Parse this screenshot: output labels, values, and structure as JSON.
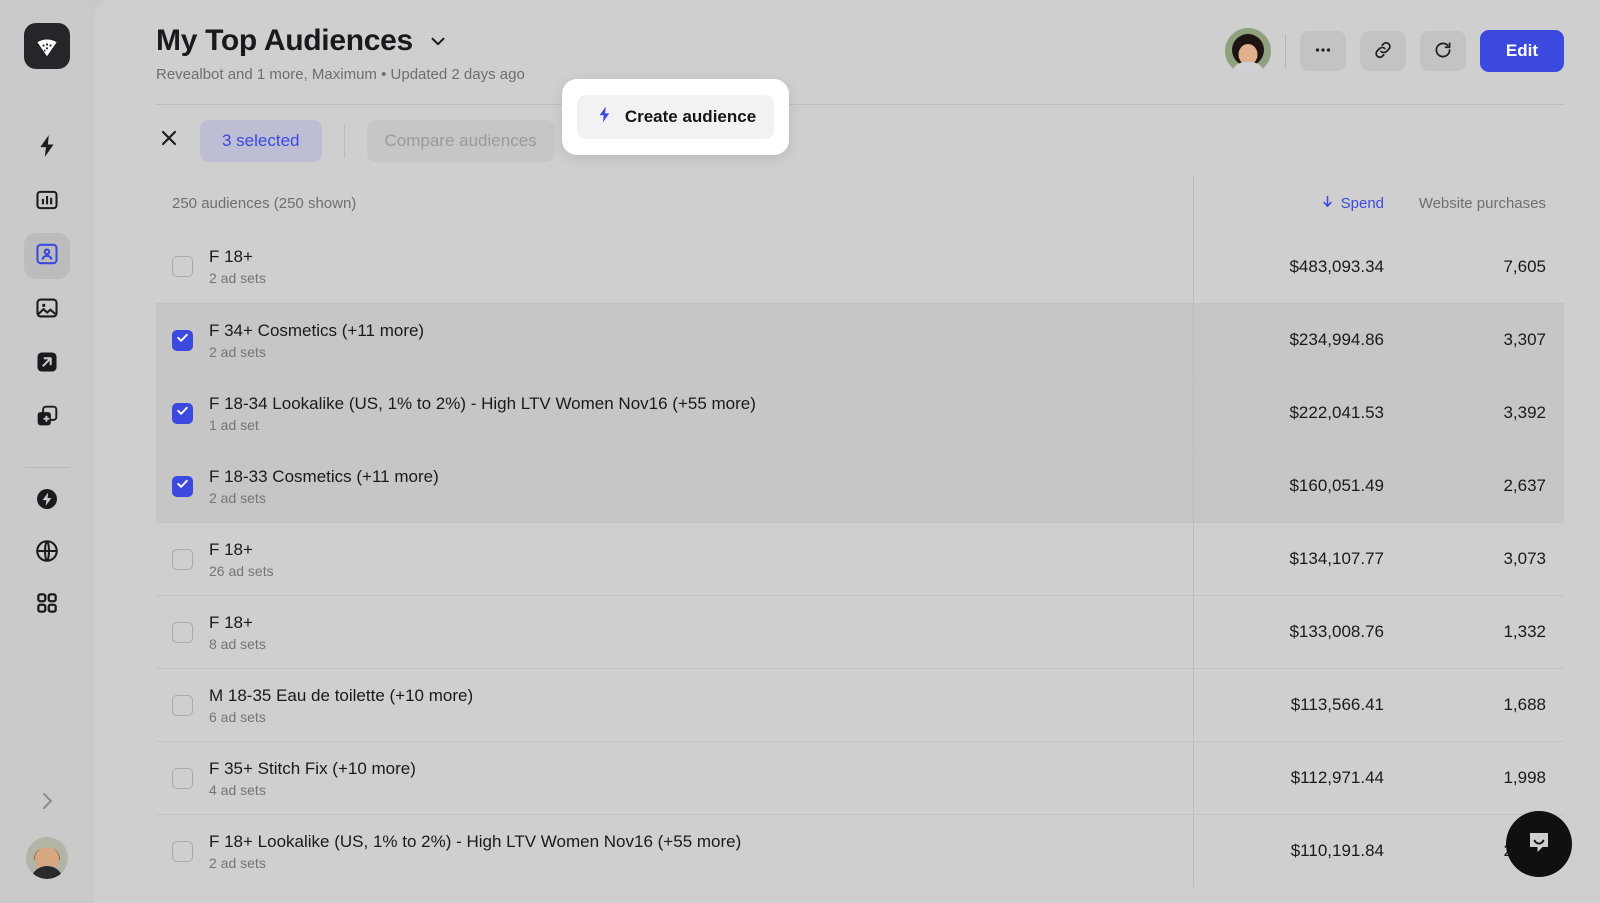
{
  "sidebar": {
    "logo": "revealbot-logo-icon",
    "items": [
      {
        "icon": "lightning-bolt-icon",
        "name": "automation",
        "active": false
      },
      {
        "icon": "bar-chart-icon",
        "name": "reports",
        "active": false
      },
      {
        "icon": "audience-person-icon",
        "name": "audiences",
        "active": true
      },
      {
        "icon": "image-icon",
        "name": "creatives",
        "active": false
      },
      {
        "icon": "arrow-up-right-box-icon",
        "name": "launch",
        "active": false
      },
      {
        "icon": "add-layers-icon",
        "name": "library",
        "active": false
      }
    ],
    "items_secondary": [
      {
        "icon": "bolt-circle-icon",
        "name": "quick-actions"
      },
      {
        "icon": "globe-icon",
        "name": "integrations"
      },
      {
        "icon": "grid-apps-icon",
        "name": "apps"
      }
    ],
    "expand_icon": "chevron-right-icon",
    "avatar": "user-avatar"
  },
  "header": {
    "title": "My Top Audiences",
    "caret_icon": "chevron-down-icon",
    "subtitle": "Revealbot and 1 more, Maximum • Updated 2 days ago",
    "avatar": "collaborator-avatar",
    "actions": [
      {
        "icon": "more-horizontal-icon",
        "name": "more-options-button"
      },
      {
        "icon": "link-icon",
        "name": "share-link-button"
      },
      {
        "icon": "refresh-icon",
        "name": "refresh-button"
      }
    ],
    "edit_label": "Edit"
  },
  "toolbar": {
    "close_icon": "close-x-icon",
    "selected_label": "3 selected",
    "compare_label": "Compare audiences",
    "create_label": "Create audience",
    "create_icon": "lightning-bolt-icon"
  },
  "table": {
    "count_label": "250 audiences (250 shown)",
    "columns": {
      "spend": "Spend",
      "spend_sort_icon": "sort-descending-arrow-icon",
      "purchases": "Website purchases"
    },
    "rows": [
      {
        "checked": false,
        "title": "F 18+",
        "subtitle": "2 ad sets",
        "spend": "$483,093.34",
        "purchases": "7,605"
      },
      {
        "checked": true,
        "title": "F 34+ Cosmetics (+11 more)",
        "subtitle": "2 ad sets",
        "spend": "$234,994.86",
        "purchases": "3,307"
      },
      {
        "checked": true,
        "title": "F 18-34 Lookalike (US, 1% to 2%) - High LTV Women Nov16 (+55 more)",
        "subtitle": "1 ad set",
        "spend": "$222,041.53",
        "purchases": "3,392"
      },
      {
        "checked": true,
        "title": "F 18-33 Cosmetics (+11 more)",
        "subtitle": "2 ad sets",
        "spend": "$160,051.49",
        "purchases": "2,637"
      },
      {
        "checked": false,
        "title": "F 18+",
        "subtitle": "26 ad sets",
        "spend": "$134,107.77",
        "purchases": "3,073"
      },
      {
        "checked": false,
        "title": "F 18+",
        "subtitle": "8 ad sets",
        "spend": "$133,008.76",
        "purchases": "1,332"
      },
      {
        "checked": false,
        "title": "M 18-35 Eau de toilette (+10 more)",
        "subtitle": "6 ad sets",
        "spend": "$113,566.41",
        "purchases": "1,688"
      },
      {
        "checked": false,
        "title": "F 35+ Stitch Fix (+10 more)",
        "subtitle": "4 ad sets",
        "spend": "$112,971.44",
        "purchases": "1,998"
      },
      {
        "checked": false,
        "title": "F 18+ Lookalike (US, 1% to 2%) - High LTV Women Nov16 (+55 more)",
        "subtitle": "2 ad sets",
        "spend": "$110,191.84",
        "purchases": "2,031"
      }
    ]
  },
  "chat": {
    "icon": "intercom-chat-icon"
  },
  "colors": {
    "accent": "#3b49df",
    "page_bg": "#cfcfcf",
    "sidebar_bg": "#cacaca",
    "selected_row": "#c6c6c6",
    "pill_bg": "#bdbed4"
  }
}
